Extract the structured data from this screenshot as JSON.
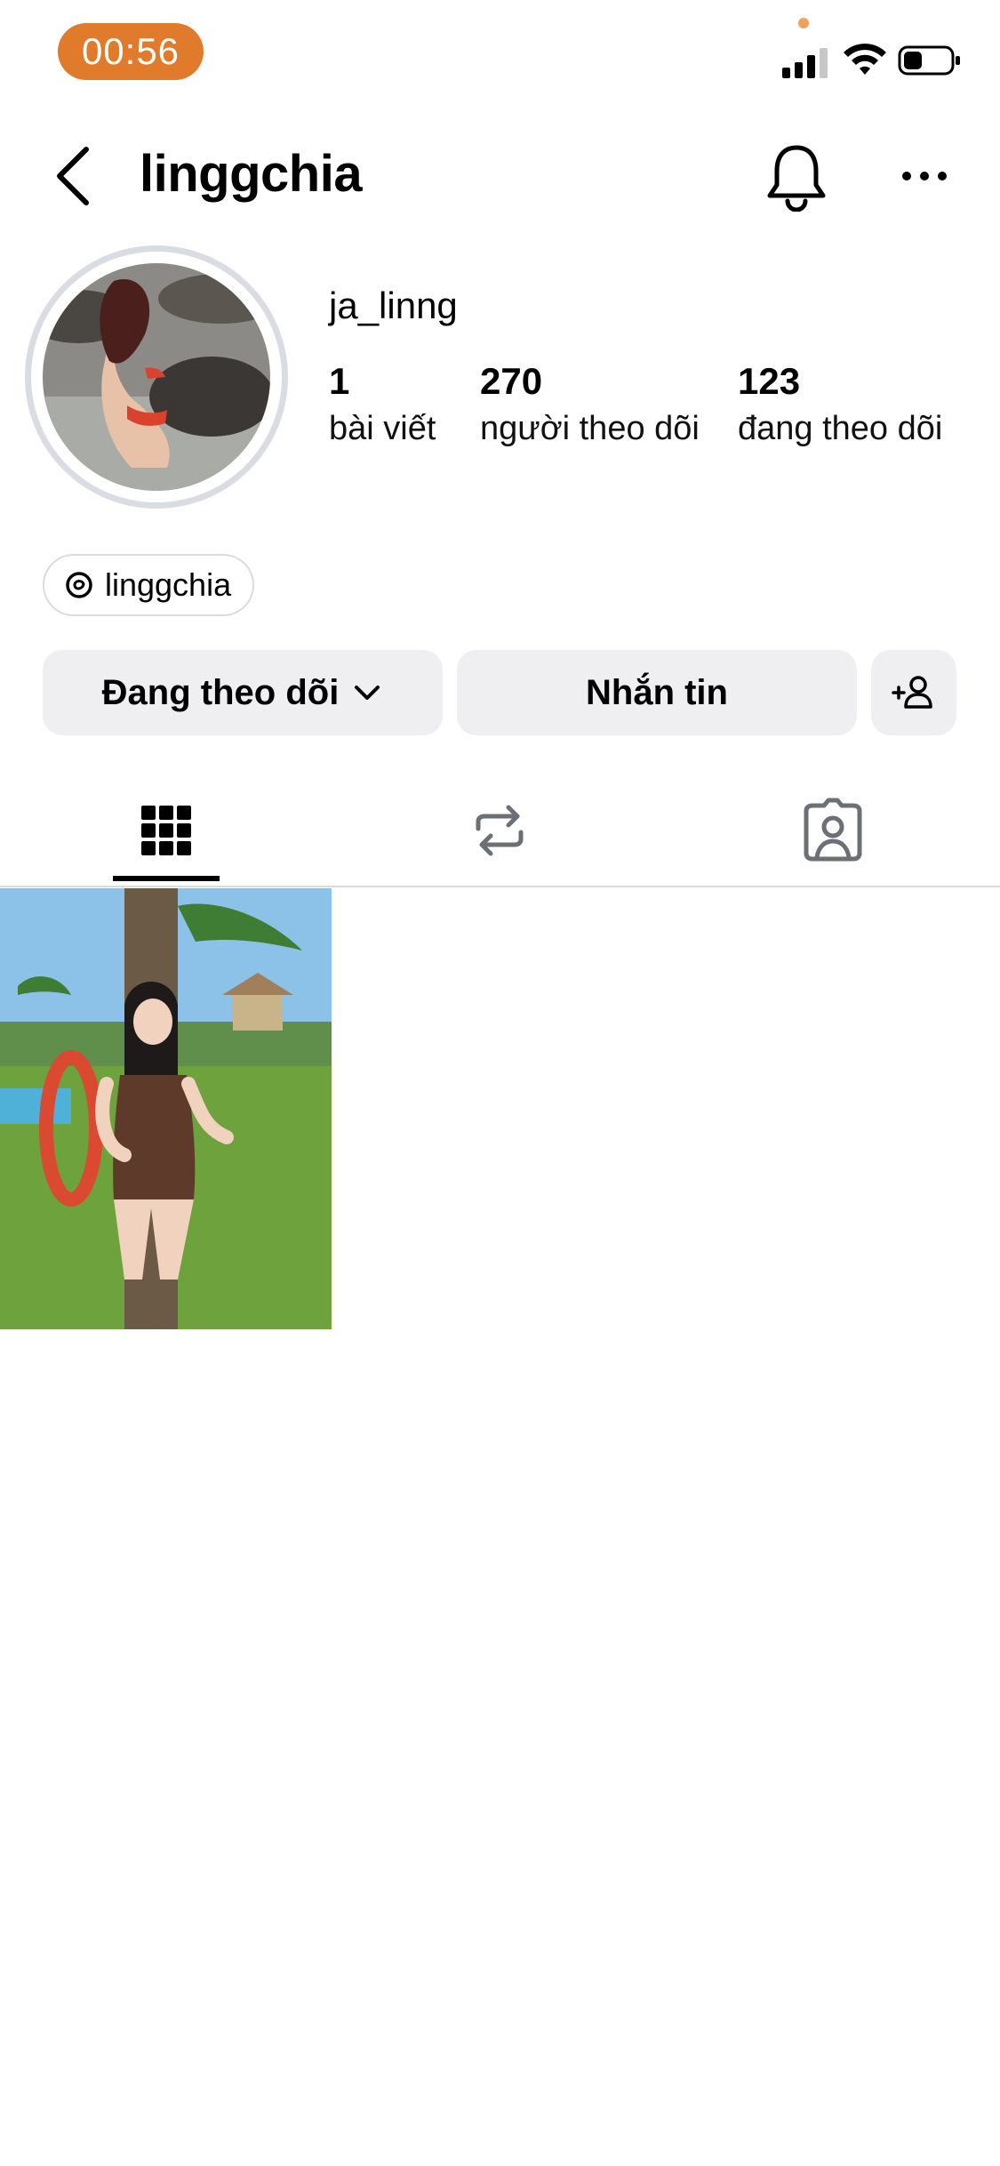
{
  "status_bar": {
    "time": "00:56",
    "accent_color": "#E07B2B",
    "icons": [
      "signal-icon",
      "wifi-icon",
      "battery-icon"
    ]
  },
  "header": {
    "title": "linggchia",
    "icons": [
      "back-arrow-icon",
      "bell-icon",
      "more-icon"
    ]
  },
  "profile": {
    "display_name": "ja_linng",
    "stats": [
      {
        "value": "1",
        "label": "bài viết"
      },
      {
        "value": "270",
        "label": "người theo dõi"
      },
      {
        "value": "123",
        "label": "đang theo dõi"
      }
    ],
    "threads_link": "linggchia"
  },
  "actions": {
    "following_label": "Đang theo dõi",
    "message_label": "Nhắn tin"
  },
  "tabs": [
    {
      "icon": "grid-icon",
      "active": true
    },
    {
      "icon": "repost-icon",
      "active": false
    },
    {
      "icon": "tagged-icon",
      "active": false
    }
  ],
  "posts_count": 1
}
